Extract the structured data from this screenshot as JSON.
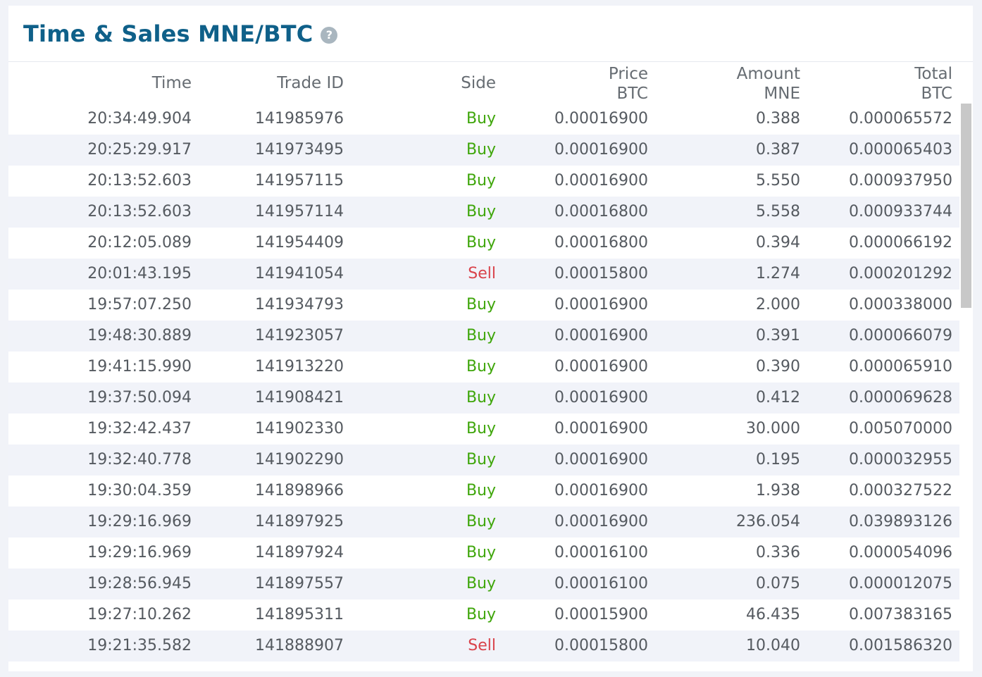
{
  "header": {
    "title": "Time & Sales MNE/BTC",
    "help_glyph": "?"
  },
  "columns": {
    "time": "Time",
    "trade_id": "Trade ID",
    "side": "Side",
    "price": "Price",
    "price_unit": "BTC",
    "amount": "Amount",
    "amount_unit": "MNE",
    "total": "Total",
    "total_unit": "BTC"
  },
  "colors": {
    "title": "#0f6089",
    "buy": "#3fa60b",
    "sell": "#d9434b"
  },
  "icons": {
    "help": "question-circle-icon"
  },
  "trades": [
    {
      "time": "20:34:49.904",
      "trade_id": "141985976",
      "side": "Buy",
      "price": "0.00016900",
      "amount": "0.388",
      "total": "0.000065572"
    },
    {
      "time": "20:25:29.917",
      "trade_id": "141973495",
      "side": "Buy",
      "price": "0.00016900",
      "amount": "0.387",
      "total": "0.000065403"
    },
    {
      "time": "20:13:52.603",
      "trade_id": "141957115",
      "side": "Buy",
      "price": "0.00016900",
      "amount": "5.550",
      "total": "0.000937950"
    },
    {
      "time": "20:13:52.603",
      "trade_id": "141957114",
      "side": "Buy",
      "price": "0.00016800",
      "amount": "5.558",
      "total": "0.000933744"
    },
    {
      "time": "20:12:05.089",
      "trade_id": "141954409",
      "side": "Buy",
      "price": "0.00016800",
      "amount": "0.394",
      "total": "0.000066192"
    },
    {
      "time": "20:01:43.195",
      "trade_id": "141941054",
      "side": "Sell",
      "price": "0.00015800",
      "amount": "1.274",
      "total": "0.000201292"
    },
    {
      "time": "19:57:07.250",
      "trade_id": "141934793",
      "side": "Buy",
      "price": "0.00016900",
      "amount": "2.000",
      "total": "0.000338000"
    },
    {
      "time": "19:48:30.889",
      "trade_id": "141923057",
      "side": "Buy",
      "price": "0.00016900",
      "amount": "0.391",
      "total": "0.000066079"
    },
    {
      "time": "19:41:15.990",
      "trade_id": "141913220",
      "side": "Buy",
      "price": "0.00016900",
      "amount": "0.390",
      "total": "0.000065910"
    },
    {
      "time": "19:37:50.094",
      "trade_id": "141908421",
      "side": "Buy",
      "price": "0.00016900",
      "amount": "0.412",
      "total": "0.000069628"
    },
    {
      "time": "19:32:42.437",
      "trade_id": "141902330",
      "side": "Buy",
      "price": "0.00016900",
      "amount": "30.000",
      "total": "0.005070000"
    },
    {
      "time": "19:32:40.778",
      "trade_id": "141902290",
      "side": "Buy",
      "price": "0.00016900",
      "amount": "0.195",
      "total": "0.000032955"
    },
    {
      "time": "19:30:04.359",
      "trade_id": "141898966",
      "side": "Buy",
      "price": "0.00016900",
      "amount": "1.938",
      "total": "0.000327522"
    },
    {
      "time": "19:29:16.969",
      "trade_id": "141897925",
      "side": "Buy",
      "price": "0.00016900",
      "amount": "236.054",
      "total": "0.039893126"
    },
    {
      "time": "19:29:16.969",
      "trade_id": "141897924",
      "side": "Buy",
      "price": "0.00016100",
      "amount": "0.336",
      "total": "0.000054096"
    },
    {
      "time": "19:28:56.945",
      "trade_id": "141897557",
      "side": "Buy",
      "price": "0.00016100",
      "amount": "0.075",
      "total": "0.000012075"
    },
    {
      "time": "19:27:10.262",
      "trade_id": "141895311",
      "side": "Buy",
      "price": "0.00015900",
      "amount": "46.435",
      "total": "0.007383165"
    },
    {
      "time": "19:21:35.582",
      "trade_id": "141888907",
      "side": "Sell",
      "price": "0.00015800",
      "amount": "10.040",
      "total": "0.001586320"
    }
  ]
}
